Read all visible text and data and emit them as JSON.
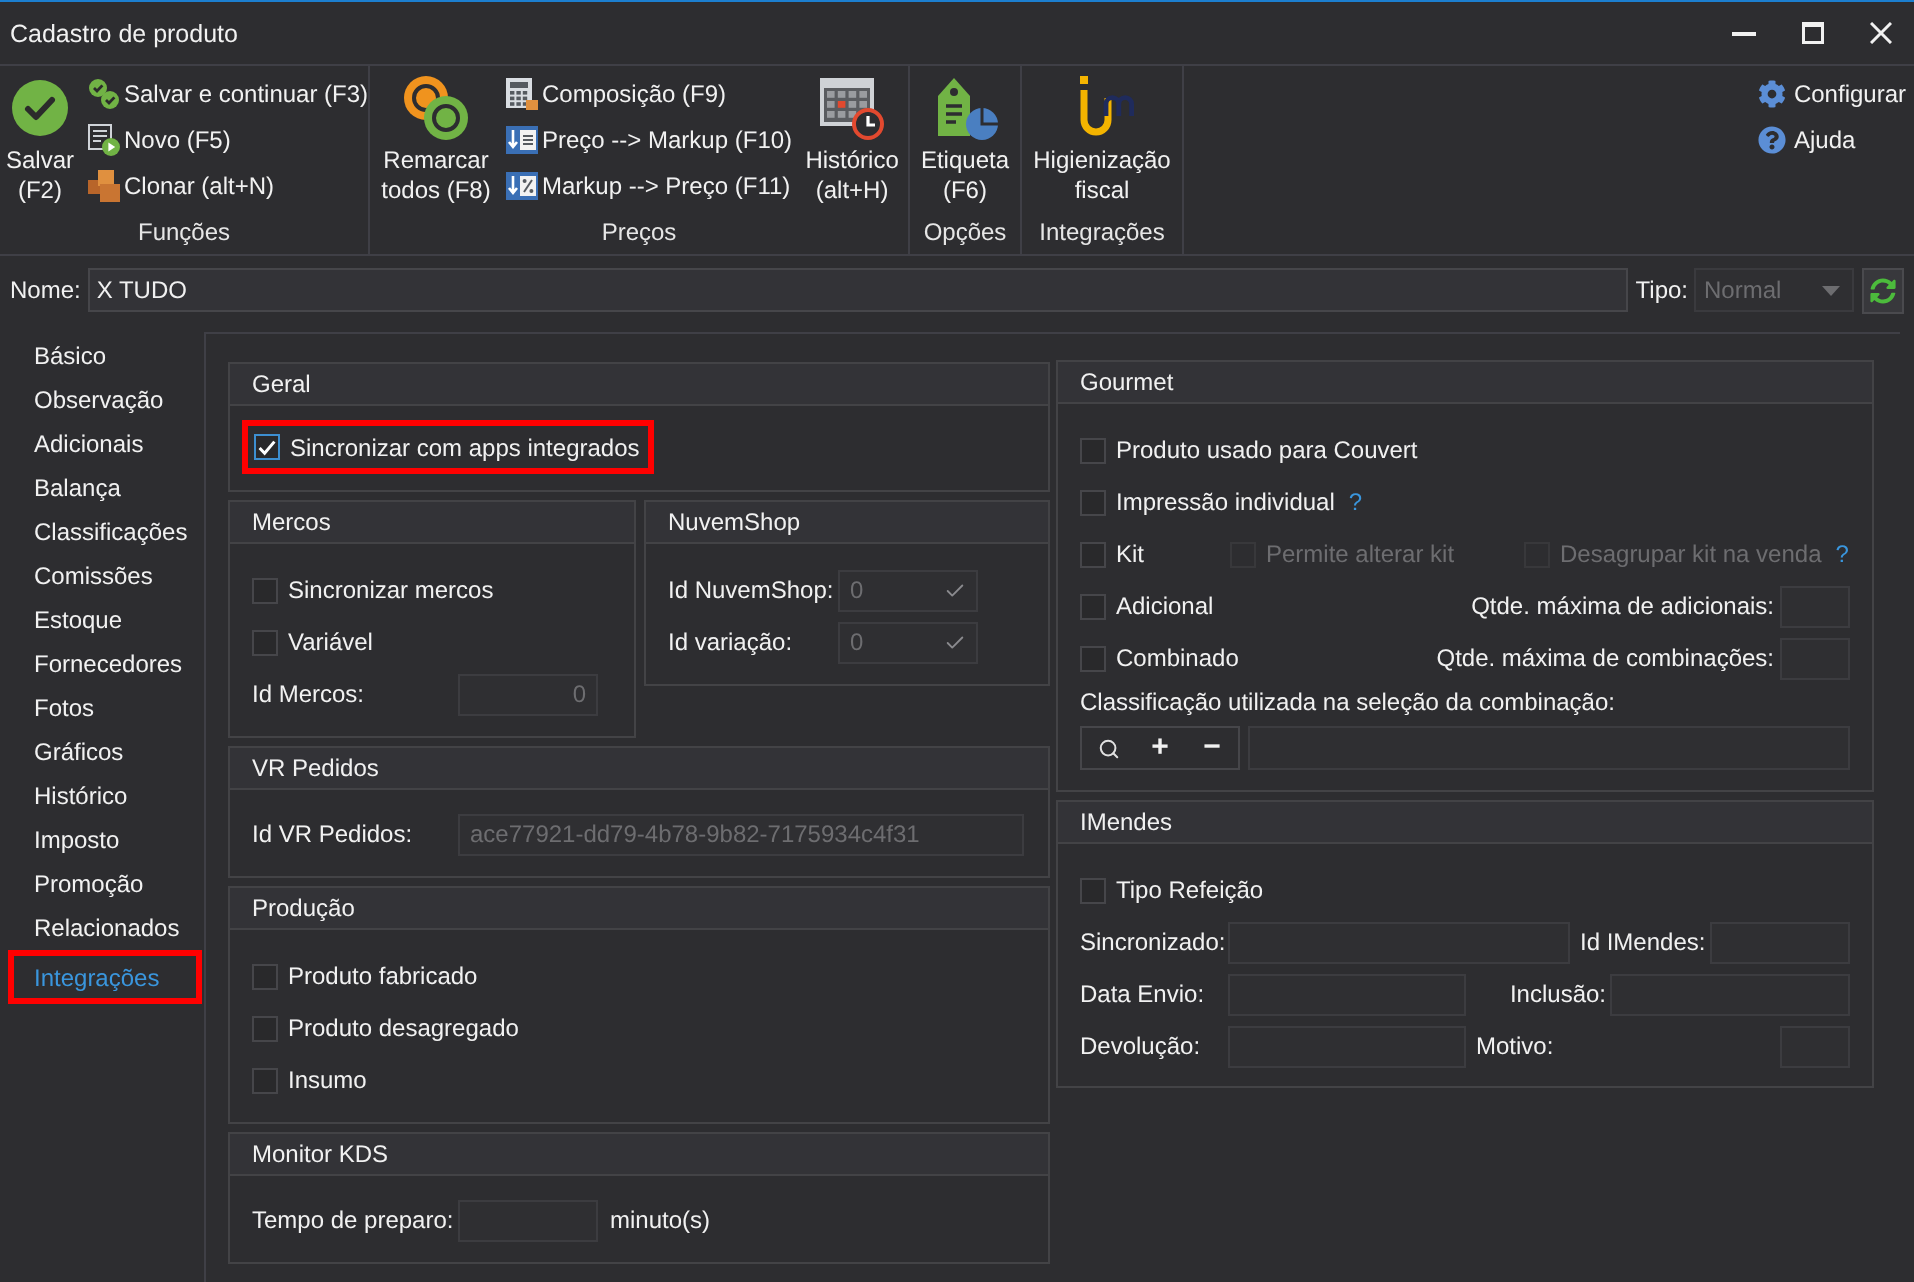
{
  "window": {
    "title": "Cadastro de produto"
  },
  "ribbon": {
    "groups": [
      {
        "label": "Funções",
        "items": [
          {
            "kind": "large",
            "lines": [
              "Salvar",
              "(F2)"
            ]
          },
          {
            "kind": "stack",
            "buttons": [
              "Salvar e continuar (F3)",
              "Novo (F5)",
              "Clonar (alt+N)"
            ]
          }
        ]
      },
      {
        "label": "Preços",
        "items": [
          {
            "kind": "large",
            "lines": [
              "Remarcar",
              "todos (F8)"
            ]
          },
          {
            "kind": "stack",
            "buttons": [
              "Composição (F9)",
              "Preço --> Markup (F10)",
              "Markup --> Preço (F11)"
            ]
          },
          {
            "kind": "large",
            "lines": [
              "Histórico",
              "(alt+H)"
            ]
          }
        ]
      },
      {
        "label": "Opções",
        "items": [
          {
            "kind": "large",
            "lines": [
              "Etiqueta",
              "(F6)"
            ]
          }
        ]
      },
      {
        "label": "Integrações",
        "items": [
          {
            "kind": "large",
            "lines": [
              "Higienização",
              "fiscal"
            ]
          }
        ]
      }
    ],
    "links": [
      "Configurar",
      "Ajuda"
    ]
  },
  "product_name": {
    "label": "Nome:",
    "value": "X TUDO"
  },
  "product_type": {
    "label": "Tipo:",
    "value": "Normal",
    "disabled": true
  },
  "sidebar": {
    "items": [
      {
        "label": "Básico",
        "selected": false,
        "highlighted": false
      },
      {
        "label": "Observação",
        "selected": false,
        "highlighted": false
      },
      {
        "label": "Adicionais",
        "selected": false,
        "highlighted": false
      },
      {
        "label": "Balança",
        "selected": false,
        "highlighted": false
      },
      {
        "label": "Classificações",
        "selected": false,
        "highlighted": false
      },
      {
        "label": "Comissões",
        "selected": false,
        "highlighted": false
      },
      {
        "label": "Estoque",
        "selected": false,
        "highlighted": false
      },
      {
        "label": "Fornecedores",
        "selected": false,
        "highlighted": false
      },
      {
        "label": "Fotos",
        "selected": false,
        "highlighted": false
      },
      {
        "label": "Gráficos",
        "selected": false,
        "highlighted": false
      },
      {
        "label": "Histórico",
        "selected": false,
        "highlighted": false
      },
      {
        "label": "Imposto",
        "selected": false,
        "highlighted": false
      },
      {
        "label": "Promoção",
        "selected": false,
        "highlighted": false
      },
      {
        "label": "Relacionados",
        "selected": false,
        "highlighted": false
      },
      {
        "label": "Integrações",
        "selected": true,
        "highlighted": true
      }
    ]
  },
  "sections": {
    "geral": {
      "title": "Geral",
      "option": {
        "label": "Sincronizar com apps integrados",
        "checked": true,
        "highlighted": true
      }
    },
    "mercos": {
      "title": "Mercos",
      "options": [
        {
          "label": "Sincronizar mercos",
          "checked": false
        },
        {
          "label": "Variável",
          "checked": false
        }
      ],
      "id_field": {
        "label": "Id Mercos:",
        "value": "0",
        "disabled": true
      }
    },
    "nuvemshop": {
      "title": "NuvemShop",
      "fields": [
        {
          "label": "Id NuvemShop:",
          "value": "0",
          "disabled": true
        },
        {
          "label": "Id variação:",
          "value": "0",
          "disabled": true
        }
      ]
    },
    "vr_pedidos": {
      "title": "VR Pedidos",
      "id_field": {
        "label": "Id VR Pedidos:",
        "value": "ace77921-dd79-4b78-9b82-7175934c4f31",
        "disabled": true
      }
    },
    "producao": {
      "title": "Produção",
      "options": [
        {
          "label": "Produto fabricado",
          "checked": false
        },
        {
          "label": "Produto desagregado",
          "checked": false
        },
        {
          "label": "Insumo",
          "checked": false
        }
      ]
    },
    "monitor_kds": {
      "title": "Monitor KDS",
      "prep_time": {
        "label": "Tempo de preparo:",
        "unit": "minuto(s)"
      }
    },
    "gourmet": {
      "title": "Gourmet",
      "options": [
        {
          "label": "Produto usado para Couvert",
          "checked": false
        },
        {
          "label": "Impressão individual",
          "checked": false,
          "help": "?"
        }
      ],
      "kit": [
        {
          "label": "Kit",
          "checked": false,
          "disabled": false
        },
        {
          "label": "Permite alterar kit",
          "checked": false,
          "disabled": true
        },
        {
          "label": "Desagrupar kit na venda",
          "checked": false,
          "disabled": true,
          "help": "?"
        }
      ],
      "limits": [
        {
          "label": "Adicional",
          "checked": false,
          "field_label": "Qtde. máxima de adicionais:"
        },
        {
          "label": "Combinado",
          "checked": false,
          "field_label": "Qtde. máxima de combinações:"
        }
      ],
      "classification": {
        "label": "Classificação utilizada na seleção da combinação:",
        "buttons": [
          "+",
          "−"
        ]
      }
    },
    "imendes": {
      "title": "IMendes",
      "option": {
        "label": "Tipo Refeição",
        "checked": false
      },
      "rows": [
        [
          {
            "label": "Sincronizado:"
          },
          {
            "label": "Id IMendes:"
          }
        ],
        [
          {
            "label": "Data Envio:"
          },
          {
            "label": "Inclusão:"
          }
        ],
        [
          {
            "label": "Devolução:"
          },
          {
            "label": "Motivo:"
          }
        ]
      ]
    }
  }
}
